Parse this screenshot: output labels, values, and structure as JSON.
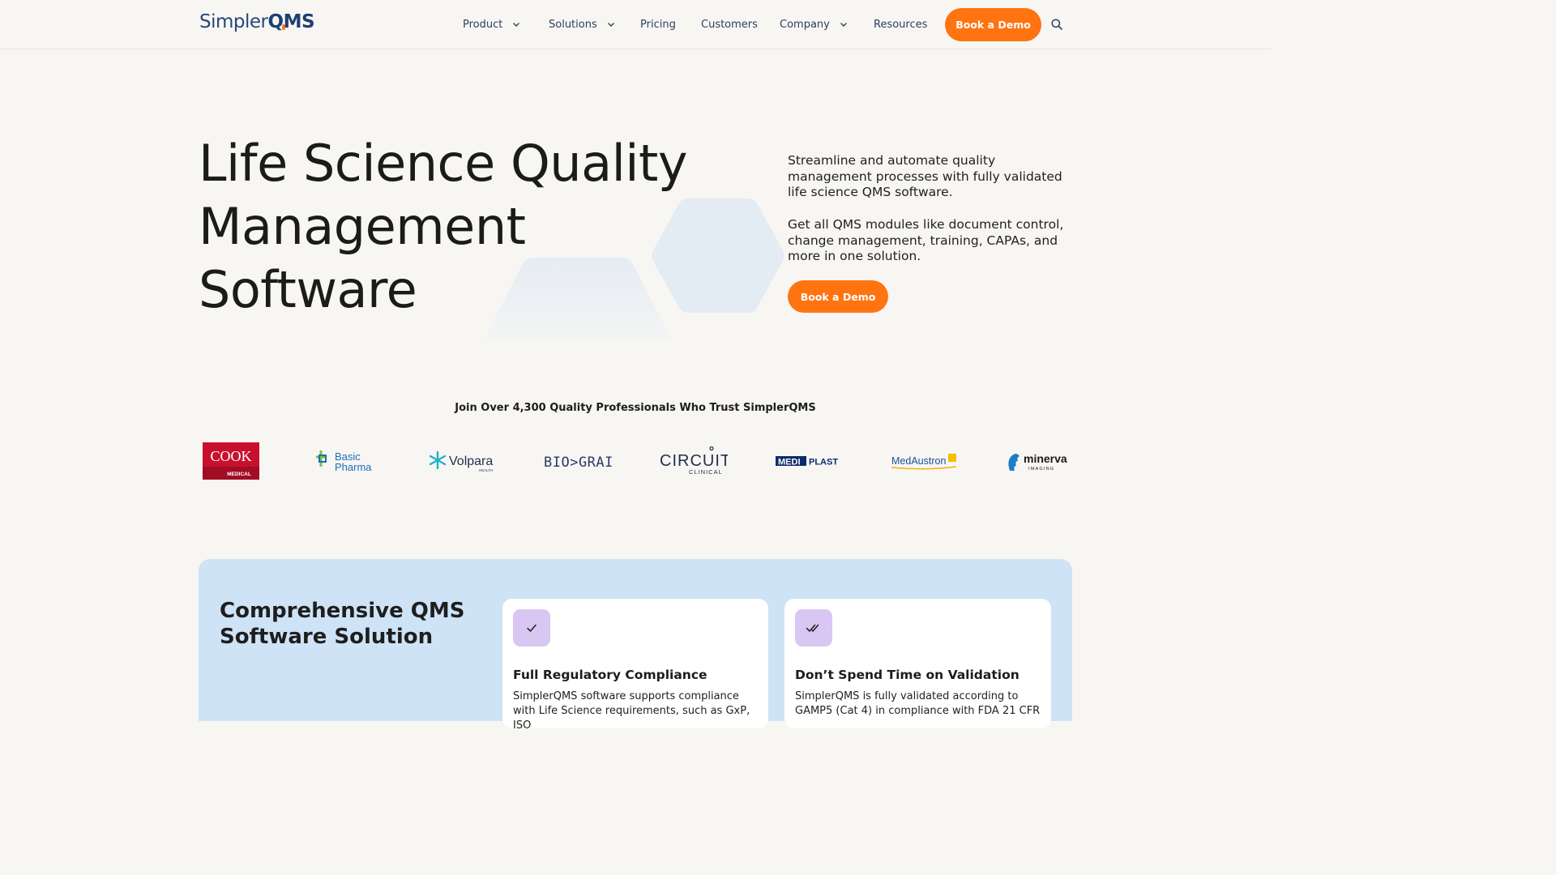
{
  "header": {
    "logo_text_a": "Simpler",
    "logo_text_b": "QMS",
    "nav": [
      {
        "label": "Product",
        "dropdown": true
      },
      {
        "label": "Solutions",
        "dropdown": true
      },
      {
        "label": "Pricing",
        "dropdown": false
      },
      {
        "label": "Customers",
        "dropdown": false
      },
      {
        "label": "Company",
        "dropdown": true
      },
      {
        "label": "Resources",
        "dropdown": false
      }
    ],
    "cta_label": "Book a Demo",
    "search_icon": "search-icon"
  },
  "hero": {
    "title_lines": [
      "Life Science Quality",
      "Management",
      "Software"
    ],
    "paragraph_1": "Streamline and automate quality management processes with fully validated life science QMS software.",
    "paragraph_2": "Get all QMS modules like document control, change management, training, CAPAs, and more in one solution.",
    "cta_label": "Book a Demo"
  },
  "trust": {
    "heading": "Join Over 4,300 Quality Professionals Who Trust SimplerQMS",
    "logos": [
      {
        "name": "COOK",
        "sub": "MEDICAL"
      },
      {
        "name": "Basic",
        "sub": "Pharma"
      },
      {
        "name": "Volpara",
        "sub": "HEALTH"
      },
      {
        "name": "BIO>GRAIL",
        "sub": ""
      },
      {
        "name": "CIRCUIT",
        "sub": "CLINICAL"
      },
      {
        "name": "MEDI",
        "sub": "PLAST"
      },
      {
        "name": "MedAustron",
        "sub": ""
      },
      {
        "name": "minerva",
        "sub": "IMAGING"
      }
    ]
  },
  "features": {
    "title": "Comprehensive QMS Software Solution",
    "cards": [
      {
        "icon": "check-icon",
        "title": "Full Regulatory Compliance",
        "text": "SimplerQMS software supports compliance with Life Science requirements, such as GxP, ISO"
      },
      {
        "icon": "double-check-icon",
        "title": "Don’t Spend Time on Validation",
        "text": "SimplerQMS is fully validated according to GAMP5 (Cat 4) in compliance with FDA 21 CFR"
      }
    ]
  },
  "colors": {
    "accent": "#ff7410",
    "brand_navy": "#1f3f73",
    "features_bg": "#cfe3f6",
    "icon_bg": "#d9c6f2"
  }
}
